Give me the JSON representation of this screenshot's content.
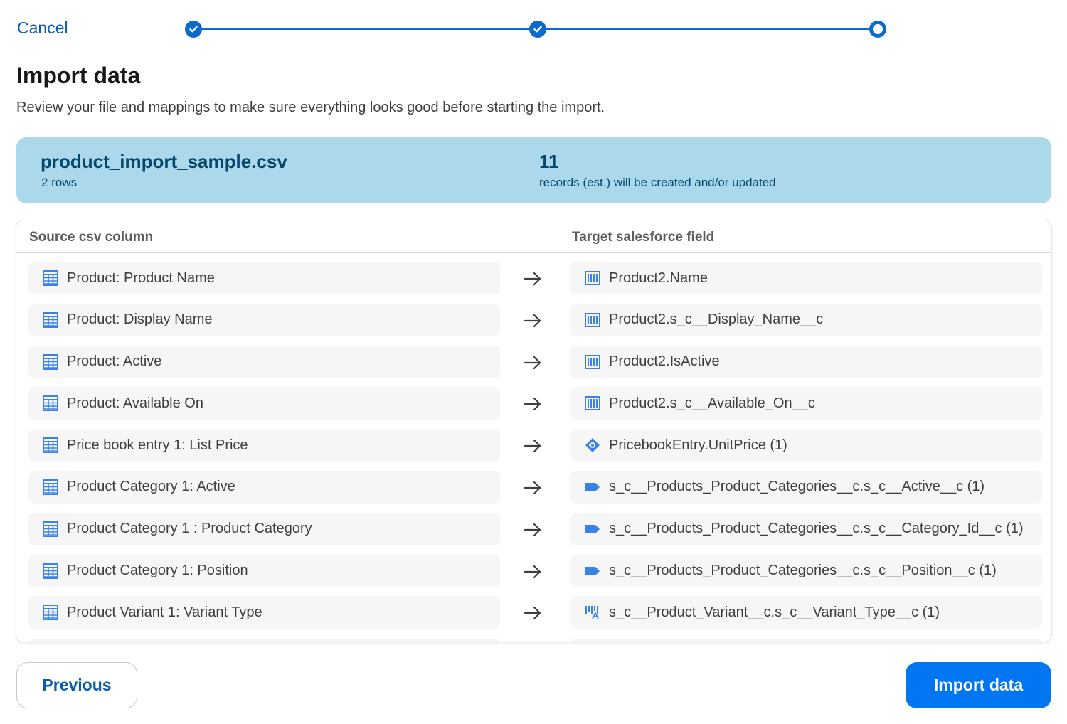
{
  "header": {
    "cancel_label": "Cancel",
    "steps": [
      {
        "state": "complete",
        "icon": "check-icon"
      },
      {
        "state": "complete",
        "icon": "check-icon"
      },
      {
        "state": "current",
        "icon": "ring-icon"
      }
    ]
  },
  "page": {
    "title": "Import data",
    "subtitle": "Review your file and mappings to make sure everything looks good before starting the import."
  },
  "summary": {
    "file_name": "product_import_sample.csv",
    "rows_text": "2 rows",
    "record_count": "11",
    "record_text": "records (est.) will be created and/or updated"
  },
  "mapping": {
    "source_header": "Source csv column",
    "target_header": "Target salesforce field",
    "rows": [
      {
        "source": "Product: Product Name",
        "target": "Product2.Name",
        "target_icon": "field-icon"
      },
      {
        "source": "Product: Display Name",
        "target": "Product2.s_c__Display_Name__c",
        "target_icon": "field-icon"
      },
      {
        "source": "Product: Active",
        "target": "Product2.IsActive",
        "target_icon": "field-icon"
      },
      {
        "source": "Product: Available On",
        "target": "Product2.s_c__Available_On__c",
        "target_icon": "field-icon"
      },
      {
        "source": "Price book entry 1: List Price",
        "target": "PricebookEntry.UnitPrice (1)",
        "target_icon": "pricebook-icon"
      },
      {
        "source": "Product Category 1: Active",
        "target": "s_c__Products_Product_Categories__c.s_c__Active__c (1)",
        "target_icon": "tag-icon"
      },
      {
        "source": "Product Category 1 : Product Category",
        "target": "s_c__Products_Product_Categories__c.s_c__Category_Id__c (1)",
        "target_icon": "tag-icon"
      },
      {
        "source": "Product Category 1: Position",
        "target": "s_c__Products_Product_Categories__c.s_c__Position__c (1)",
        "target_icon": "tag-icon"
      },
      {
        "source": "Product Variant 1: Variant Type",
        "target": "s_c__Product_Variant__c.s_c__Variant_Type__c (1)",
        "target_icon": "variant-icon"
      }
    ]
  },
  "footer": {
    "previous_label": "Previous",
    "import_label": "Import data"
  },
  "colors": {
    "accent": "#0b6bcb",
    "summary_bg": "#acd8ec",
    "summary_text": "#06476b",
    "primary_button": "#0176f3",
    "cell_bg": "#f6f6f6",
    "icon_blue": "#3b82e8"
  }
}
